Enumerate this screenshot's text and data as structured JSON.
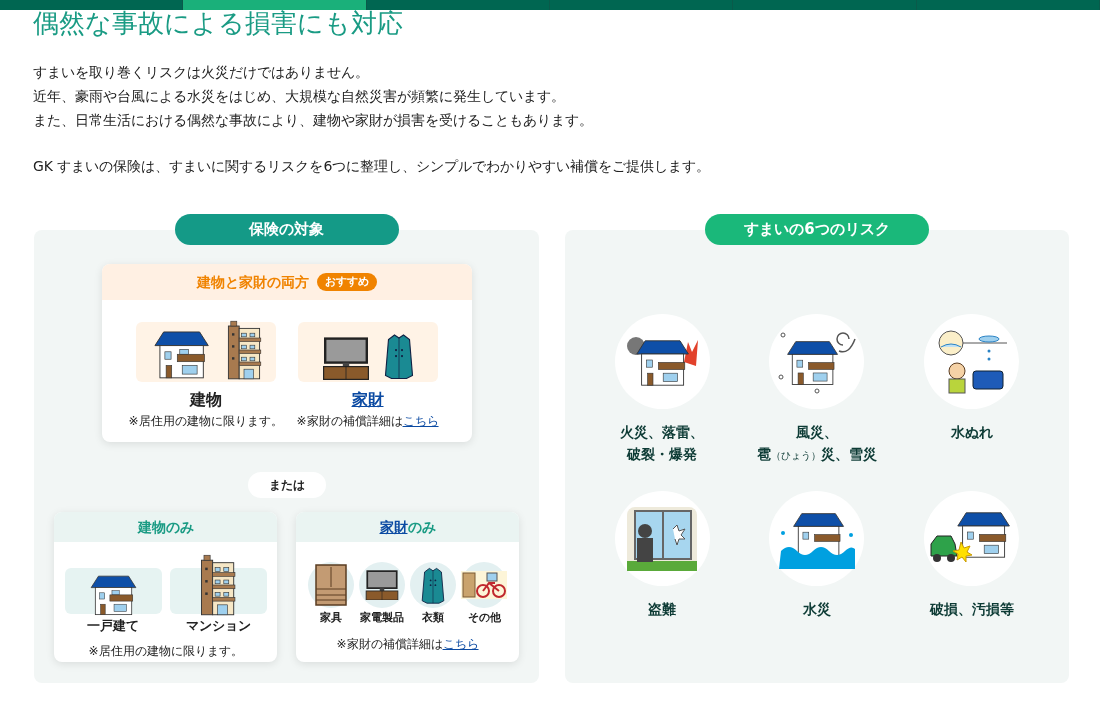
{
  "nav_strip": {
    "segments": [
      {
        "selected": false
      },
      {
        "selected": true
      },
      {
        "selected": false
      },
      {
        "selected": false
      },
      {
        "selected": false
      },
      {
        "selected": false
      }
    ]
  },
  "heading": "偶然な事故による損害にも対応",
  "intro": [
    "すまいを取り巻くリスクは火災だけではありません。",
    "近年、豪雨や台風による水災をはじめ、大規模な自然災害が頻繁に発生しています。",
    "また、日常生活における偶然な事故により、建物や家財が損害を受けることもあります。"
  ],
  "summary": "GK すまいの保険は、すまいに関するリスクを6つに整理し、シンプルでわかりやすい補償をご提供します。",
  "coverage": {
    "title": "保険の対象",
    "both": {
      "title": "建物と家財の両方",
      "badge": "おすすめ",
      "items": [
        {
          "kind": "building",
          "label": "建物",
          "link": false,
          "note": "※居住用の建物に限ります。"
        },
        {
          "kind": "contents",
          "label": "家財",
          "link": true,
          "note": "※家財の補償詳細は",
          "note_link": "こちら"
        }
      ]
    },
    "separator": "または",
    "building_only": {
      "title": "建物のみ",
      "items": [
        {
          "kind": "house",
          "label": "一戸建て"
        },
        {
          "kind": "apartment",
          "label": "マンション"
        }
      ],
      "note": "※居住用の建物に限ります。"
    },
    "contents_only": {
      "title_link": "家財",
      "title": "のみ",
      "items": [
        {
          "kind": "furniture",
          "label": "家具"
        },
        {
          "kind": "appliance",
          "label": "家電製品"
        },
        {
          "kind": "clothing",
          "label": "衣類"
        },
        {
          "kind": "other",
          "label": "その他"
        }
      ],
      "note": "※家財の補償詳細は",
      "note_link": "こちら"
    }
  },
  "risks": {
    "title": "すまいの6つのリスク",
    "items": [
      {
        "kind": "fire",
        "lines": [
          [
            {
              "text": "火災、落雷、",
              "small": false
            }
          ],
          [
            {
              "text": "破裂・爆発",
              "small": false
            }
          ]
        ]
      },
      {
        "kind": "storm",
        "lines": [
          [
            {
              "text": "風災、",
              "small": false
            }
          ],
          [
            {
              "text": "雹",
              "small": false
            },
            {
              "text": "（ひょう）",
              "small": true
            },
            {
              "text": "災、雪災",
              "small": false
            }
          ]
        ]
      },
      {
        "kind": "leak",
        "lines": [
          [
            {
              "text": "水ぬれ",
              "small": false
            }
          ]
        ]
      },
      {
        "kind": "theft",
        "lines": [
          [
            {
              "text": "盗難",
              "small": false
            }
          ]
        ]
      },
      {
        "kind": "flood",
        "lines": [
          [
            {
              "text": "水災",
              "small": false
            }
          ]
        ]
      },
      {
        "kind": "damage",
        "lines": [
          [
            {
              "text": "破損、汚損等",
              "small": false
            }
          ]
        ]
      }
    ]
  }
}
